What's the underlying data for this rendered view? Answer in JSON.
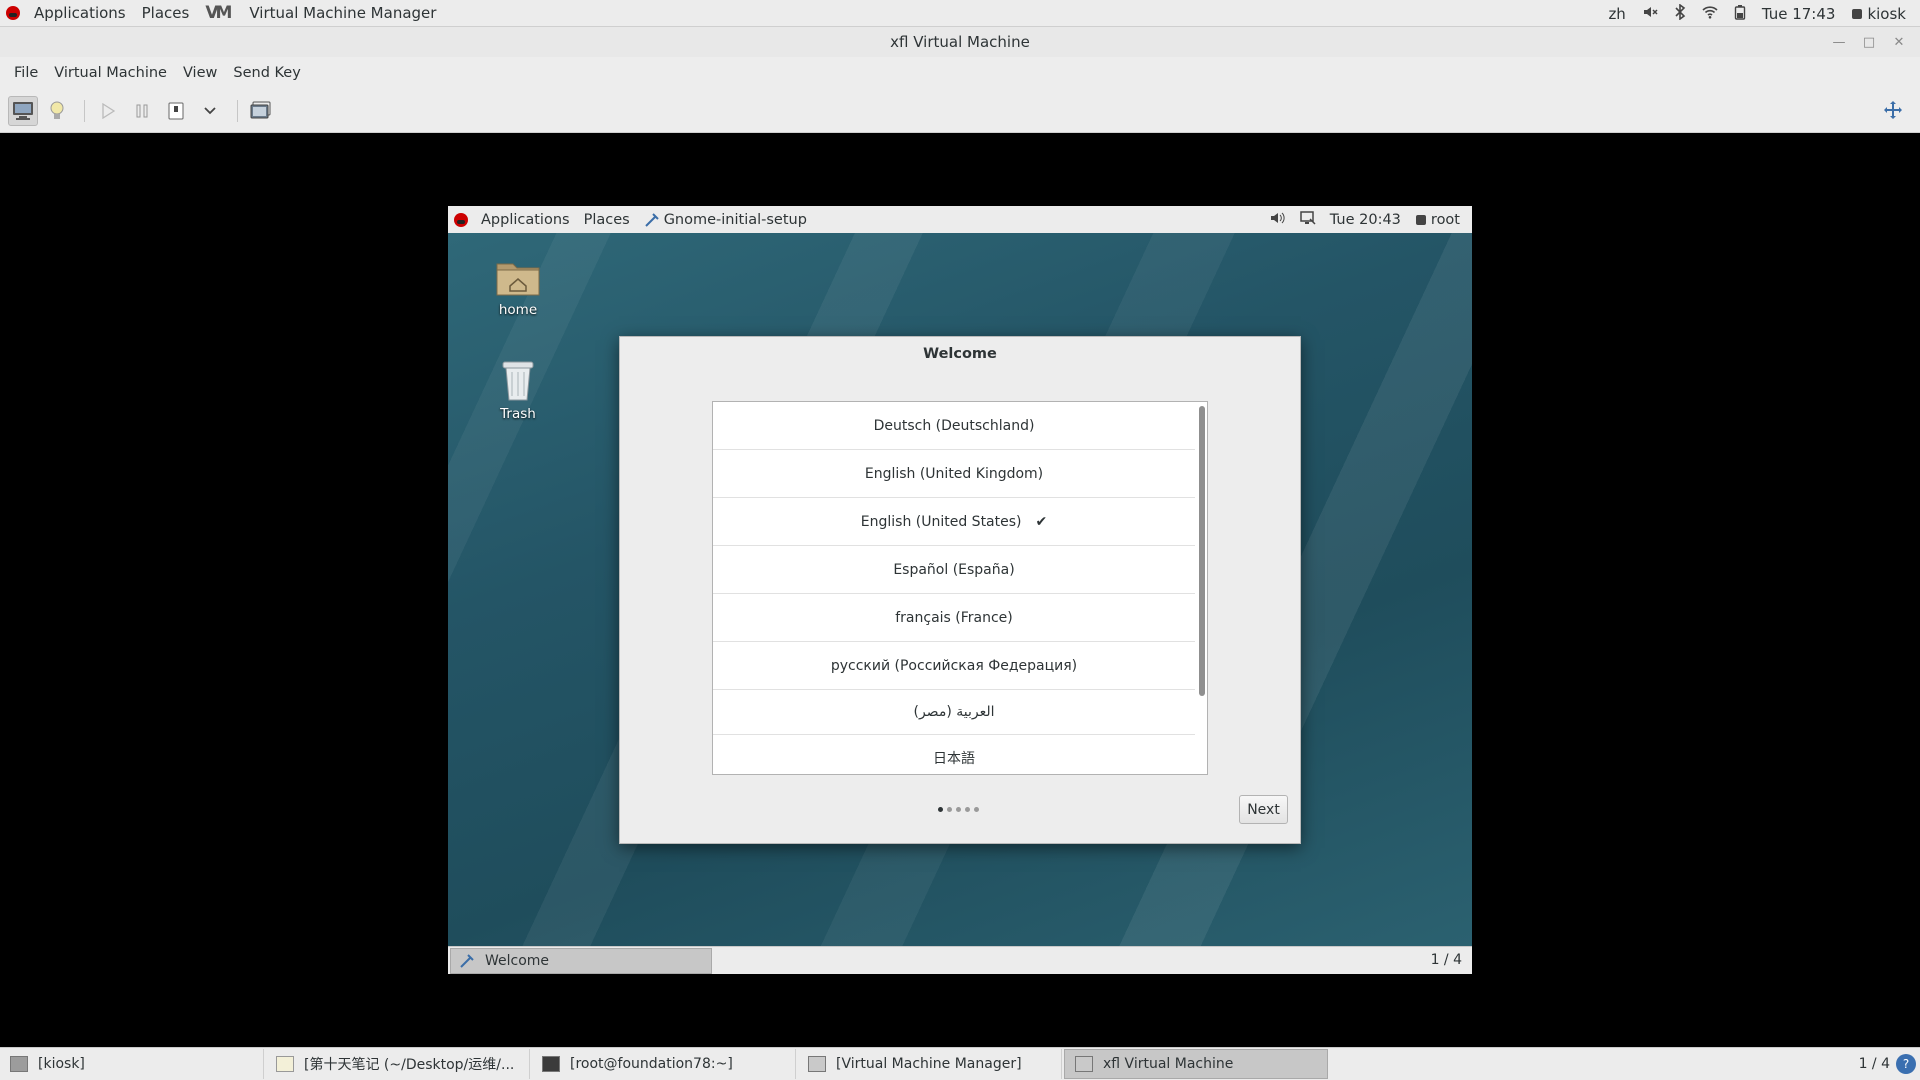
{
  "host_topbar": {
    "applications": "Applications",
    "places": "Places",
    "active_app": "Virtual Machine Manager",
    "input_method": "zh",
    "clock": "Tue 17:43",
    "user": "kiosk"
  },
  "window": {
    "title": "xfl Virtual Machine"
  },
  "menubar": {
    "items": [
      "File",
      "Virtual Machine",
      "View",
      "Send Key"
    ]
  },
  "guest": {
    "topbar": {
      "applications": "Applications",
      "places": "Places",
      "active_app": "Gnome-initial-setup",
      "clock": "Tue 20:43",
      "user": "root"
    },
    "desktop_icons": [
      {
        "label": "home"
      },
      {
        "label": "Trash"
      }
    ],
    "dialog": {
      "title": "Welcome",
      "languages": [
        {
          "label": "Deutsch (Deutschland)",
          "selected": false
        },
        {
          "label": "English (United Kingdom)",
          "selected": false
        },
        {
          "label": "English (United States)",
          "selected": true
        },
        {
          "label": "Español (España)",
          "selected": false
        },
        {
          "label": "français (France)",
          "selected": false
        },
        {
          "label": "русский (Российская Федерация)",
          "selected": false
        },
        {
          "label": "العربية (مصر)",
          "selected": false
        },
        {
          "label": "日本語",
          "selected": false
        }
      ],
      "check_mark": "✔",
      "page_dots": 5,
      "current_page": 1,
      "next_label": "Next"
    },
    "taskbar": {
      "task_label": "Welcome",
      "pager": "1 / 4"
    }
  },
  "host_taskbar": {
    "tasks": [
      {
        "label": "[kiosk]",
        "active": false
      },
      {
        "label": "[第十天笔记 (~/Desktop/运维/...",
        "active": false
      },
      {
        "label": "[root@foundation78:~]",
        "active": false
      },
      {
        "label": "[Virtual Machine Manager]",
        "active": false
      },
      {
        "label": "xfl Virtual Machine",
        "active": true
      }
    ],
    "pager": "1 / 4",
    "help": "?"
  }
}
